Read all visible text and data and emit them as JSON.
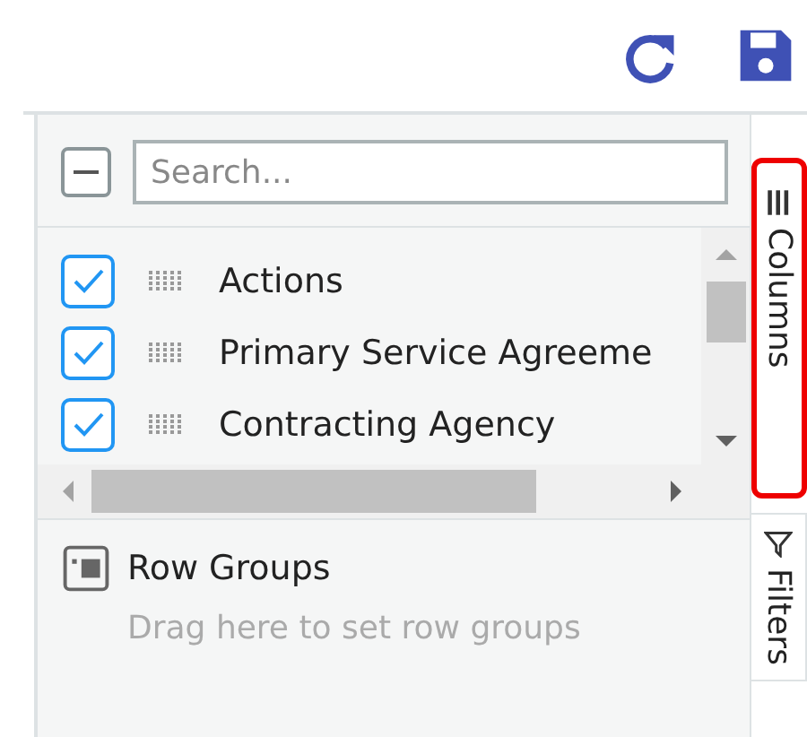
{
  "select_all": {
    "indeterminate": true
  },
  "search": {
    "placeholder": "Search..."
  },
  "columns": [
    {
      "label": "Actions",
      "checked": true
    },
    {
      "label": "Primary Service Agreeme",
      "checked": true
    },
    {
      "label": "Contracting Agency",
      "checked": true
    }
  ],
  "row_groups": {
    "title": "Row Groups",
    "hint": "Drag here to set row groups"
  },
  "side_tabs": [
    {
      "label": "Columns",
      "kind": "columns",
      "selected": true
    },
    {
      "label": "Filters",
      "kind": "filters",
      "selected": false
    }
  ]
}
